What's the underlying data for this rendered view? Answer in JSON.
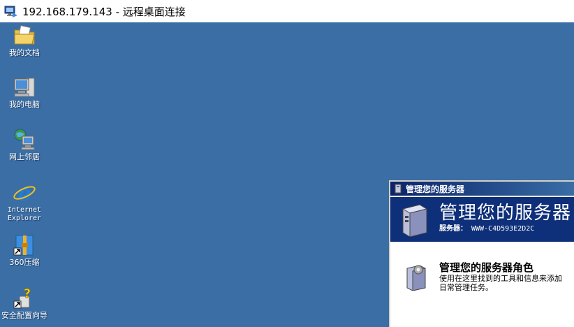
{
  "titlebar": {
    "title": "192.168.179.143 - 远程桌面连接",
    "icon": "remote-desktop-icon"
  },
  "desktop": {
    "background": "#3a6ea5",
    "icons": [
      {
        "label": "我的文档",
        "icon": "my-documents-icon"
      },
      {
        "label": "我的电脑",
        "icon": "my-computer-icon"
      },
      {
        "label": "网上邻居",
        "icon": "network-places-icon"
      },
      {
        "label": "Internet\nExplorer",
        "icon": "internet-explorer-icon"
      },
      {
        "label": "360压缩",
        "icon": "360-zip-icon"
      },
      {
        "label": "安全配置向导",
        "icon": "security-wizard-icon"
      }
    ]
  },
  "server_window": {
    "title": "管理您的服务器",
    "banner_heading": "管理您的服务器",
    "server_label": "服务器：",
    "server_name": "WWW-C4D593E2D2C",
    "section_heading": "管理您的服务器角色",
    "section_desc_line1": "使用在这里找到的工具和信息来添加",
    "section_desc_line2": "日常管理任务。"
  }
}
